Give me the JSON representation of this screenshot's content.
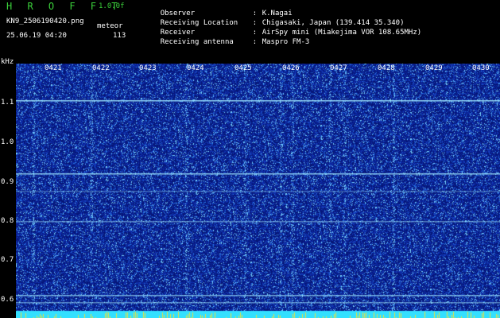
{
  "header": {
    "app_title": "H R O F F T",
    "app_version": "1.0.0f",
    "file_name": "KN9_2506190420.png",
    "mode": "meteor",
    "timestamp": "25.06.19 04:20",
    "count": "113",
    "info": [
      {
        "label": "Observer",
        "value": "K.Nagai"
      },
      {
        "label": "Receiving Location",
        "value": "Chigasaki, Japan (139.414 35.340)"
      },
      {
        "label": "Receiver",
        "value": "AirSpy mini (Miakejima VOR 108.65MHz)"
      },
      {
        "label": "Receiving antenna",
        "value": "Maspro FM-3"
      }
    ],
    "separator": ":"
  },
  "axis": {
    "y_unit": "kHz",
    "y_ticks": [
      "1.1",
      "1.0",
      "0.9",
      "0.8",
      "0.7",
      "0.6"
    ],
    "x_ticks": [
      "0421",
      "0422",
      "0423",
      "0424",
      "0425",
      "0426",
      "0427",
      "0428",
      "0429",
      "0430"
    ]
  },
  "colors": {
    "background": "#0a1e8c",
    "title_green": "#3bd13b",
    "carrier_line": "#9fe8ff",
    "bottom_band": "#33e0ff"
  }
}
